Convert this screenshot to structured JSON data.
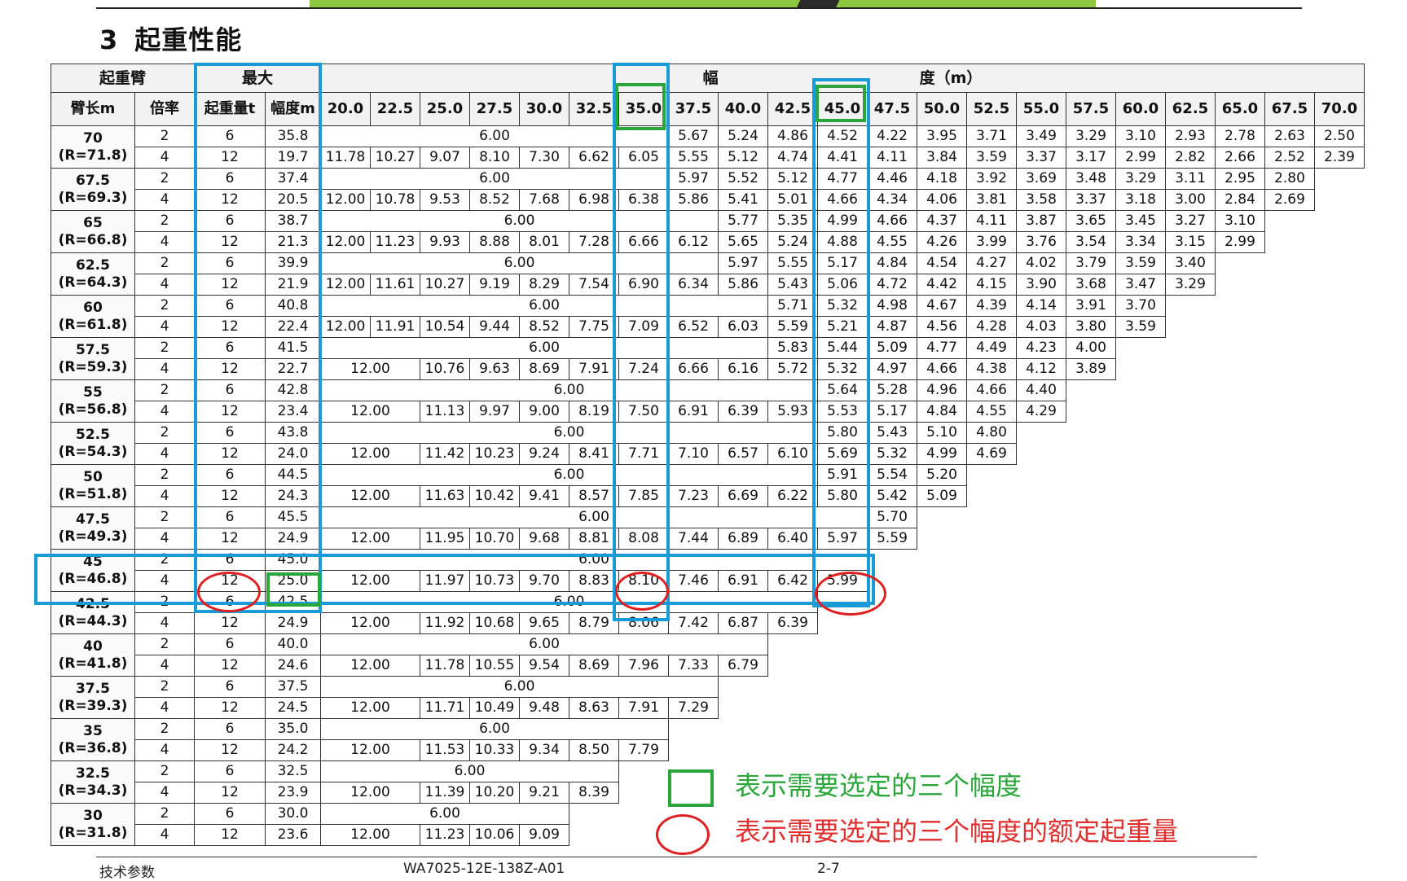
{
  "section": {
    "number": "3",
    "title": "起重性能"
  },
  "table": {
    "header_row1": {
      "boom": "起重臂",
      "max": "最大",
      "radius": "幅　　　　　　　　　　　　　度（m）"
    },
    "header_row2": [
      "臂长m",
      "倍率",
      "起重量t",
      "幅度m",
      "20.0",
      "22.5",
      "25.0",
      "27.5",
      "30.0",
      "32.5",
      "35.0",
      "37.5",
      "40.0",
      "42.5",
      "45.0",
      "47.5",
      "50.0",
      "52.5",
      "55.0",
      "57.5",
      "60.0",
      "62.5",
      "65.0",
      "67.5",
      "70.0"
    ],
    "groups": [
      {
        "boom": "70",
        "r": "(R=71.8)",
        "rows": [
          {
            "f": "2",
            "max": [
              "6",
              "35.8"
            ],
            "cells": [
              [
                "6.00",
                7
              ],
              "5.67",
              "5.24",
              "4.86",
              "4.52",
              "4.22",
              "3.95",
              "3.71",
              "3.49",
              "3.29",
              "3.10",
              "2.93",
              "2.78",
              "2.63",
              "2.50"
            ]
          },
          {
            "f": "4",
            "max": [
              "12",
              "19.7"
            ],
            "cells": [
              "11.78",
              "10.27",
              "9.07",
              "8.10",
              "7.30",
              "6.62",
              "6.05",
              "5.55",
              "5.12",
              "4.74",
              "4.41",
              "4.11",
              "3.84",
              "3.59",
              "3.37",
              "3.17",
              "2.99",
              "2.82",
              "2.66",
              "2.52",
              "2.39"
            ]
          }
        ]
      },
      {
        "boom": "67.5",
        "r": "(R=69.3)",
        "rows": [
          {
            "f": "2",
            "max": [
              "6",
              "37.4"
            ],
            "cells": [
              [
                "6.00",
                7
              ],
              "5.97",
              "5.52",
              "5.12",
              "4.77",
              "4.46",
              "4.18",
              "3.92",
              "3.69",
              "3.48",
              "3.29",
              "3.11",
              "2.95",
              "2.80"
            ]
          },
          {
            "f": "4",
            "max": [
              "12",
              "20.5"
            ],
            "cells": [
              "12.00",
              "10.78",
              "9.53",
              "8.52",
              "7.68",
              "6.98",
              "6.38",
              "5.86",
              "5.41",
              "5.01",
              "4.66",
              "4.34",
              "4.06",
              "3.81",
              "3.58",
              "3.37",
              "3.18",
              "3.00",
              "2.84",
              "2.69"
            ]
          }
        ]
      },
      {
        "boom": "65",
        "r": "(R=66.8)",
        "rows": [
          {
            "f": "2",
            "max": [
              "6",
              "38.7"
            ],
            "cells": [
              [
                "6.00",
                8
              ],
              "5.77",
              "5.35",
              "4.99",
              "4.66",
              "4.37",
              "4.11",
              "3.87",
              "3.65",
              "3.45",
              "3.27",
              "3.10"
            ]
          },
          {
            "f": "4",
            "max": [
              "12",
              "21.3"
            ],
            "cells": [
              "12.00",
              "11.23",
              "9.93",
              "8.88",
              "8.01",
              "7.28",
              "6.66",
              "6.12",
              "5.65",
              "5.24",
              "4.88",
              "4.55",
              "4.26",
              "3.99",
              "3.76",
              "3.54",
              "3.34",
              "3.15",
              "2.99"
            ]
          }
        ]
      },
      {
        "boom": "62.5",
        "r": "(R=64.3)",
        "rows": [
          {
            "f": "2",
            "max": [
              "6",
              "39.9"
            ],
            "cells": [
              [
                "6.00",
                8
              ],
              "5.97",
              "5.55",
              "5.17",
              "4.84",
              "4.54",
              "4.27",
              "4.02",
              "3.79",
              "3.59",
              "3.40"
            ]
          },
          {
            "f": "4",
            "max": [
              "12",
              "21.9"
            ],
            "cells": [
              "12.00",
              "11.61",
              "10.27",
              "9.19",
              "8.29",
              "7.54",
              "6.90",
              "6.34",
              "5.86",
              "5.43",
              "5.06",
              "4.72",
              "4.42",
              "4.15",
              "3.90",
              "3.68",
              "3.47",
              "3.29"
            ]
          }
        ]
      },
      {
        "boom": "60",
        "r": "(R=61.8)",
        "rows": [
          {
            "f": "2",
            "max": [
              "6",
              "40.8"
            ],
            "cells": [
              [
                "6.00",
                9
              ],
              "5.71",
              "5.32",
              "4.98",
              "4.67",
              "4.39",
              "4.14",
              "3.91",
              "3.70"
            ]
          },
          {
            "f": "4",
            "max": [
              "12",
              "22.4"
            ],
            "cells": [
              "12.00",
              "11.91",
              "10.54",
              "9.44",
              "8.52",
              "7.75",
              "7.09",
              "6.52",
              "6.03",
              "5.59",
              "5.21",
              "4.87",
              "4.56",
              "4.28",
              "4.03",
              "3.80",
              "3.59"
            ]
          }
        ]
      },
      {
        "boom": "57.5",
        "r": "(R=59.3)",
        "rows": [
          {
            "f": "2",
            "max": [
              "6",
              "41.5"
            ],
            "cells": [
              [
                "6.00",
                9
              ],
              "5.83",
              "5.44",
              "5.09",
              "4.77",
              "4.49",
              "4.23",
              "4.00"
            ]
          },
          {
            "f": "4",
            "max": [
              "12",
              "22.7"
            ],
            "cells": [
              [
                "12.00",
                2
              ],
              "10.76",
              "9.63",
              "8.69",
              "7.91",
              "7.24",
              "6.66",
              "6.16",
              "5.72",
              "5.32",
              "4.97",
              "4.66",
              "4.38",
              "4.12",
              "3.89"
            ]
          }
        ]
      },
      {
        "boom": "55",
        "r": "(R=56.8)",
        "rows": [
          {
            "f": "2",
            "max": [
              "6",
              "42.8"
            ],
            "cells": [
              [
                "6.00",
                10
              ],
              "5.64",
              "5.28",
              "4.96",
              "4.66",
              "4.40"
            ]
          },
          {
            "f": "4",
            "max": [
              "12",
              "23.4"
            ],
            "cells": [
              [
                "12.00",
                2
              ],
              "11.13",
              "9.97",
              "9.00",
              "8.19",
              "7.50",
              "6.91",
              "6.39",
              "5.93",
              "5.53",
              "5.17",
              "4.84",
              "4.55",
              "4.29"
            ]
          }
        ]
      },
      {
        "boom": "52.5",
        "r": "(R=54.3)",
        "rows": [
          {
            "f": "2",
            "max": [
              "6",
              "43.8"
            ],
            "cells": [
              [
                "6.00",
                10
              ],
              "5.80",
              "5.43",
              "5.10",
              "4.80"
            ]
          },
          {
            "f": "4",
            "max": [
              "12",
              "24.0"
            ],
            "cells": [
              [
                "12.00",
                2
              ],
              "11.42",
              "10.23",
              "9.24",
              "8.41",
              "7.71",
              "7.10",
              "6.57",
              "6.10",
              "5.69",
              "5.32",
              "4.99",
              "4.69"
            ]
          }
        ]
      },
      {
        "boom": "50",
        "r": "(R=51.8)",
        "rows": [
          {
            "f": "2",
            "max": [
              "6",
              "44.5"
            ],
            "cells": [
              [
                "6.00",
                10
              ],
              "5.91",
              "5.54",
              "5.20"
            ]
          },
          {
            "f": "4",
            "max": [
              "12",
              "24.3"
            ],
            "cells": [
              [
                "12.00",
                2
              ],
              "11.63",
              "10.42",
              "9.41",
              "8.57",
              "7.85",
              "7.23",
              "6.69",
              "6.22",
              "5.80",
              "5.42",
              "5.09"
            ]
          }
        ]
      },
      {
        "boom": "47.5",
        "r": "(R=49.3)",
        "rows": [
          {
            "f": "2",
            "max": [
              "6",
              "45.5"
            ],
            "cells": [
              [
                "6.00",
                11
              ],
              "5.70"
            ]
          },
          {
            "f": "4",
            "max": [
              "12",
              "24.9"
            ],
            "cells": [
              [
                "12.00",
                2
              ],
              "11.95",
              "10.70",
              "9.68",
              "8.81",
              "8.08",
              "7.44",
              "6.89",
              "6.40",
              "5.97",
              "5.59"
            ]
          }
        ]
      },
      {
        "boom": "45",
        "r": "(R=46.8)",
        "rows": [
          {
            "f": "2",
            "max": [
              "6",
              "45.0"
            ],
            "cells": [
              [
                "6.00",
                11
              ]
            ]
          },
          {
            "f": "4",
            "max": [
              "12",
              "25.0"
            ],
            "cells": [
              [
                "12.00",
                2
              ],
              "11.97",
              "10.73",
              "9.70",
              "8.83",
              "8.10",
              "7.46",
              "6.91",
              "6.42",
              "5.99"
            ]
          }
        ]
      },
      {
        "boom": "42.5",
        "r": "(R=44.3)",
        "rows": [
          {
            "f": "2",
            "max": [
              "6",
              "42.5"
            ],
            "cells": [
              [
                "6.00",
                10
              ]
            ]
          },
          {
            "f": "4",
            "max": [
              "12",
              "24.9"
            ],
            "cells": [
              [
                "12.00",
                2
              ],
              "11.92",
              "10.68",
              "9.65",
              "8.79",
              "8.06",
              "7.42",
              "6.87",
              "6.39"
            ]
          }
        ]
      },
      {
        "boom": "40",
        "r": "(R=41.8)",
        "rows": [
          {
            "f": "2",
            "max": [
              "6",
              "40.0"
            ],
            "cells": [
              [
                "6.00",
                9
              ]
            ]
          },
          {
            "f": "4",
            "max": [
              "12",
              "24.6"
            ],
            "cells": [
              [
                "12.00",
                2
              ],
              "11.78",
              "10.55",
              "9.54",
              "8.69",
              "7.96",
              "7.33",
              "6.79"
            ]
          }
        ]
      },
      {
        "boom": "37.5",
        "r": "(R=39.3)",
        "rows": [
          {
            "f": "2",
            "max": [
              "6",
              "37.5"
            ],
            "cells": [
              [
                "6.00",
                8
              ]
            ]
          },
          {
            "f": "4",
            "max": [
              "12",
              "24.5"
            ],
            "cells": [
              [
                "12.00",
                2
              ],
              "11.71",
              "10.49",
              "9.48",
              "8.63",
              "7.91",
              "7.29"
            ]
          }
        ]
      },
      {
        "boom": "35",
        "r": "(R=36.8)",
        "rows": [
          {
            "f": "2",
            "max": [
              "6",
              "35.0"
            ],
            "cells": [
              [
                "6.00",
                7
              ]
            ]
          },
          {
            "f": "4",
            "max": [
              "12",
              "24.2"
            ],
            "cells": [
              [
                "12.00",
                2
              ],
              "11.53",
              "10.33",
              "9.34",
              "8.50",
              "7.79"
            ]
          }
        ]
      },
      {
        "boom": "32.5",
        "r": "(R=34.3)",
        "rows": [
          {
            "f": "2",
            "max": [
              "6",
              "32.5"
            ],
            "cells": [
              [
                "6.00",
                6
              ]
            ]
          },
          {
            "f": "4",
            "max": [
              "12",
              "23.9"
            ],
            "cells": [
              [
                "12.00",
                2
              ],
              "11.39",
              "10.20",
              "9.21",
              "8.39"
            ]
          }
        ]
      },
      {
        "boom": "30",
        "r": "(R=31.8)",
        "rows": [
          {
            "f": "2",
            "max": [
              "6",
              "30.0"
            ],
            "cells": [
              [
                "6.00",
                5
              ]
            ]
          },
          {
            "f": "4",
            "max": [
              "12",
              "23.6"
            ],
            "cells": [
              [
                "12.00",
                2
              ],
              "11.23",
              "10.06",
              "9.09"
            ]
          }
        ]
      }
    ]
  },
  "legend": {
    "green_text": "表示需要选定的三个幅度",
    "red_text": "表示需要选定的三个幅度的额定起重量",
    "green_color": "#2aa63a",
    "red_color": "#e02020",
    "blue_color": "#1a9bd8"
  },
  "footer": {
    "left": "技术参数",
    "center": "WA7025-12E-138Z-A01",
    "right": "2-7"
  }
}
